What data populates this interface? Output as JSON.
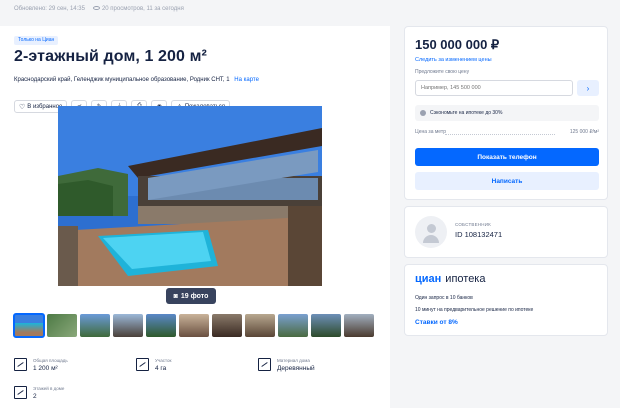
{
  "meta": {
    "updated": "Обновлено: 29 сен, 14:35",
    "views": "20 просмотров, 11 за сегодня"
  },
  "listing": {
    "badge": "Только на Циан",
    "title": "2-этажный дом, 1 200 м²",
    "address": "Краснодарский край, Геленджик муниципальное образование, Родник СНТ, 1",
    "map_link": "На карте"
  },
  "actions": {
    "favorite": "В избранное",
    "complain": "Пожаловаться"
  },
  "gallery": {
    "photo_count": "19 фото",
    "thumb_count": 11
  },
  "features": [
    {
      "label": "Общая площадь",
      "value": "1 200 м²"
    },
    {
      "label": "Участок",
      "value": "4 га"
    },
    {
      "label": "Материал дома",
      "value": "Деревянный"
    },
    {
      "label": "Этажей в доме",
      "value": "2"
    }
  ],
  "price_card": {
    "price": "150 000 000 ₽",
    "follow": "Следить за изменением цены",
    "offer_label": "Предложите свою цену",
    "offer_placeholder": "Например, 145 500 000",
    "mortgage_note": "Сэкономьте на ипотеке до 30%",
    "ppm_label": "Цена за метр",
    "ppm_value": "125 000 ₽/м²",
    "show_phone": "Показать телефон",
    "write": "Написать"
  },
  "owner": {
    "role": "СОБСТВЕННИК",
    "id": "ID 108132471"
  },
  "cian": {
    "brand": "циан",
    "product": "ипотека",
    "line1": "Один запрос в 10 банков",
    "line2": "10 минут на предварительное решение по ипотеке",
    "rate": "Ставки от 8%"
  },
  "colors": {
    "accent": "#0468ff",
    "text": "#152242"
  }
}
